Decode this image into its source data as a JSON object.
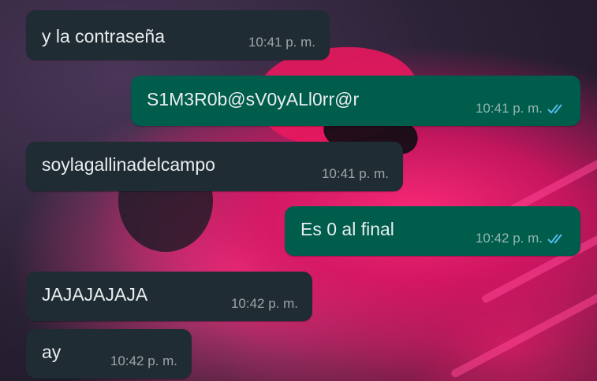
{
  "chat": {
    "messages": [
      {
        "direction": "incoming",
        "text": "y la contraseña",
        "time": "10:41 p. m."
      },
      {
        "direction": "outgoing",
        "text": "S1M3R0b@sV0yALl0rr@r",
        "time": "10:41 p. m.",
        "status": "read",
        "status_icon": "double-check-icon"
      },
      {
        "direction": "incoming",
        "text": "soylagallinadelcampo",
        "time": "10:41 p. m."
      },
      {
        "direction": "outgoing",
        "text": "Es 0 al final",
        "time": "10:42 p. m.",
        "status": "read",
        "status_icon": "double-check-icon"
      },
      {
        "direction": "incoming",
        "text": "JAJAJAJAJA",
        "time": "10:42 p. m."
      },
      {
        "direction": "incoming",
        "text": "ay",
        "time": "10:42 p. m."
      }
    ]
  },
  "colors": {
    "incoming_bubble": "#1f2c33",
    "outgoing_bubble": "#005c4b",
    "read_ticks": "#53bdeb"
  }
}
